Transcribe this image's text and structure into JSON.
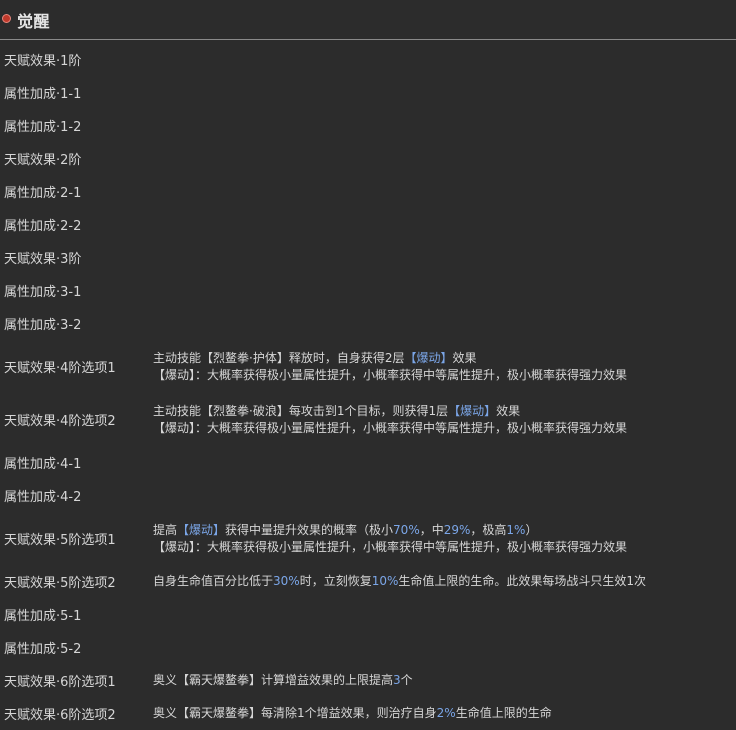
{
  "header": {
    "title": "觉醒",
    "icon": "red-circle-icon"
  },
  "rows": [
    {
      "label": "天赋效果·1阶",
      "lines": []
    },
    {
      "label": "属性加成·1-1",
      "lines": []
    },
    {
      "label": "属性加成·1-2",
      "lines": []
    },
    {
      "label": "天赋效果·2阶",
      "lines": []
    },
    {
      "label": "属性加成·2-1",
      "lines": []
    },
    {
      "label": "属性加成·2-2",
      "lines": []
    },
    {
      "label": "天赋效果·3阶",
      "lines": []
    },
    {
      "label": "属性加成·3-1",
      "lines": []
    },
    {
      "label": "属性加成·3-2",
      "lines": []
    },
    {
      "label": "天赋效果·4阶选项1",
      "lines": [
        [
          {
            "t": "主动技能【烈鳌拳·护体】释放时，自身获得2层"
          },
          {
            "t": "【爆动】",
            "hl": true
          },
          {
            "t": "效果"
          }
        ],
        [
          {
            "t": "【爆动】：大概率获得极小量属性提升，小概率获得中等属性提升，极小概率获得强力效果"
          }
        ]
      ]
    },
    {
      "label": "天赋效果·4阶选项2",
      "lines": [
        [
          {
            "t": "主动技能【烈鳌拳·破浪】每攻击到1个目标，则获得1层"
          },
          {
            "t": "【爆动】",
            "hl": true
          },
          {
            "t": "效果"
          }
        ],
        [
          {
            "t": "【爆动】：大概率获得极小量属性提升，小概率获得中等属性提升，极小概率获得强力效果"
          }
        ]
      ]
    },
    {
      "label": "属性加成·4-1",
      "lines": []
    },
    {
      "label": "属性加成·4-2",
      "lines": []
    },
    {
      "label": "天赋效果·5阶选项1",
      "lines": [
        [
          {
            "t": "提高"
          },
          {
            "t": "【爆动】",
            "hl": true
          },
          {
            "t": "获得中量提升效果的概率（极小"
          },
          {
            "t": "70%",
            "hl": true
          },
          {
            "t": "，中"
          },
          {
            "t": "29%",
            "hl": true
          },
          {
            "t": "，极高"
          },
          {
            "t": "1%",
            "hl": true
          },
          {
            "t": "）"
          }
        ],
        [
          {
            "t": "【爆动】：大概率获得极小量属性提升，小概率获得中等属性提升，极小概率获得强力效果"
          }
        ]
      ]
    },
    {
      "label": "天赋效果·5阶选项2",
      "lines": [
        [
          {
            "t": "自身生命值百分比低于"
          },
          {
            "t": "30%",
            "hl": true
          },
          {
            "t": "时，立刻恢复"
          },
          {
            "t": "10%",
            "hl": true
          },
          {
            "t": "生命值上限的生命。此效果每场战斗只生效1次"
          }
        ]
      ]
    },
    {
      "label": "属性加成·5-1",
      "lines": []
    },
    {
      "label": "属性加成·5-2",
      "lines": []
    },
    {
      "label": "天赋效果·6阶选项1",
      "lines": [
        [
          {
            "t": "奥义【霸天爆鳌拳】计算增益效果的上限提高"
          },
          {
            "t": "3",
            "hl": true
          },
          {
            "t": "个"
          }
        ]
      ]
    },
    {
      "label": "天赋效果·6阶选项2",
      "lines": [
        [
          {
            "t": "奥义【霸天爆鳌拳】每清除1个增益效果，则治疗自身"
          },
          {
            "t": "2%",
            "hl": true
          },
          {
            "t": "生命值上限的生命"
          }
        ]
      ]
    }
  ]
}
